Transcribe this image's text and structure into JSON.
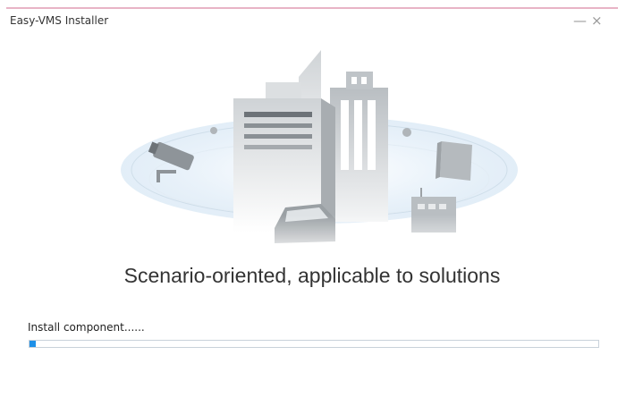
{
  "window": {
    "title": "Easy-VMS Installer",
    "minimize_glyph": "—",
    "close_glyph": "×"
  },
  "illustration": {
    "icon": "smart-city-illustration-icon"
  },
  "slogan": "Scenario-oriented, applicable to solutions",
  "install": {
    "status_text": "Install component......",
    "progress_fraction": 0.011,
    "bar_color": "#1e90e8"
  }
}
